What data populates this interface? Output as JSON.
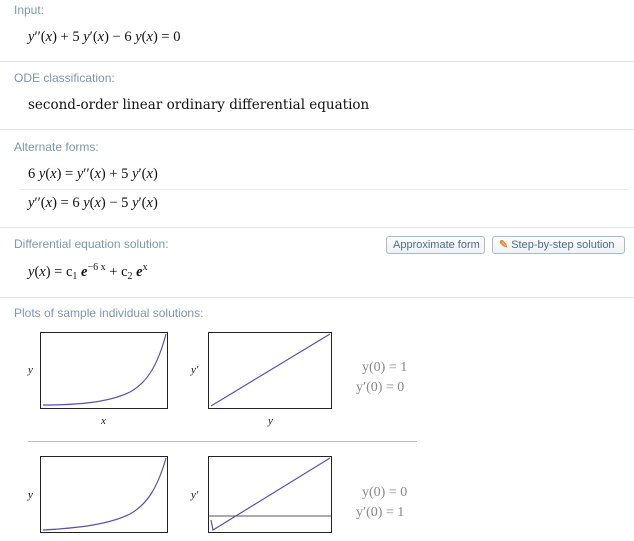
{
  "pods": {
    "input": {
      "title": "Input:"
    },
    "classification": {
      "title": "ODE classification:",
      "text": "second-order linear ordinary differential equation"
    },
    "alternate": {
      "title": "Alternate forms:"
    },
    "solution": {
      "title": "Differential equation solution:",
      "approx_button": "Approximate form",
      "step_button": "Step-by-step solution"
    },
    "plots": {
      "title": "Plots of sample individual solutions:"
    }
  },
  "math": {
    "input": [
      "y",
      "′′(",
      "x",
      ") + 5 ",
      "y",
      "′(",
      "x",
      ") − 6 ",
      "y",
      "(",
      "x",
      ") = 0"
    ],
    "alt1": [
      "6 ",
      "y",
      "(",
      "x",
      ") = ",
      "y",
      "′′(",
      "x",
      ") + 5 ",
      "y",
      "′(",
      "x",
      ")"
    ],
    "alt2": [
      "y",
      "′′(",
      "x",
      ") = 6 ",
      "y",
      "(",
      "x",
      ") − 5 ",
      "y",
      "′(",
      "x",
      ")"
    ],
    "solution": {
      "lhs": "y",
      "x": "x",
      "c1": "c",
      "sub1": "1",
      "e": "e",
      "exp1": "−6 x",
      "c2": "c",
      "sub2": "2",
      "exp2": "x"
    }
  },
  "plots": {
    "axis_labels": {
      "y": "y",
      "yprime": "y′",
      "x": "x",
      "y_below": "y"
    },
    "rows": [
      {
        "ic1": "y(0) = 1",
        "ic2": "y′(0) = 0"
      },
      {
        "ic1": "y(0) = 0",
        "ic2": "y′(0) = 1"
      }
    ]
  },
  "colors": {
    "curve": "#5b4fb0",
    "title": "#7d96ad",
    "border": "#e2e2e2"
  }
}
